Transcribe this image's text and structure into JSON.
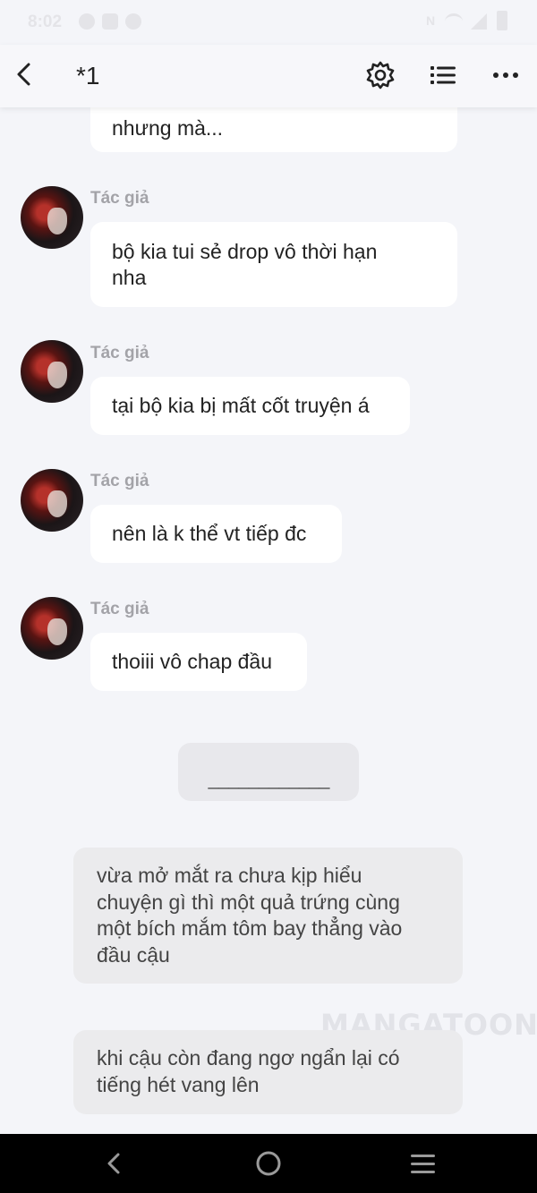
{
  "status_bar": {
    "time": "8:02"
  },
  "header": {
    "title": "*1",
    "icons": {
      "back": "back-arrow-icon",
      "settings": "gear-icon",
      "list": "list-icon",
      "more": "more-dots-icon"
    }
  },
  "chat": {
    "partial_message": "nhưng mà...",
    "messages": [
      {
        "author": "Tác giả",
        "text_line1": "bộ kia tui sẻ drop vô thời hạn",
        "text_line2": "nha"
      },
      {
        "author": "Tác giả",
        "text": "tại bộ kia bị mất cốt truyện á"
      },
      {
        "author": "Tác giả",
        "text": "nên là k thể vt tiếp đc"
      },
      {
        "author": "Tác giả",
        "text": "thoiii vô chap đầu"
      }
    ],
    "separator": "____________",
    "narration": [
      {
        "lines": [
          "vừa mở mắt ra chưa kịp hiểu",
          "chuyện gì thì một quả trứng cùng",
          "một bích mắm tôm bay thẳng vào",
          "đầu cậu"
        ]
      },
      {
        "lines": [
          "khi cậu còn đang ngơ ngẩn lại có",
          "tiếng hét vang lên"
        ]
      }
    ],
    "watermark": "MANGATOON"
  },
  "nav_bar": {
    "icons": [
      "nav-back-icon",
      "nav-home-icon",
      "nav-recents-icon"
    ]
  }
}
